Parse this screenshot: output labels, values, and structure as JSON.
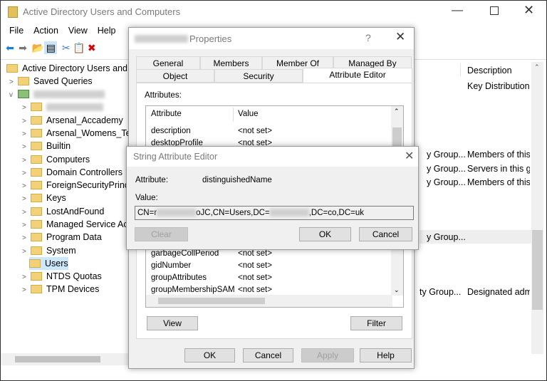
{
  "main": {
    "title": "Active Directory Users and Computers",
    "menu": [
      "File",
      "Action",
      "View",
      "Help"
    ],
    "tree": [
      {
        "label": "Active Directory Users and Computers",
        "chev": ""
      },
      {
        "label": "Saved Queries",
        "chev": ">"
      },
      {
        "label": "",
        "chev": "v"
      },
      {
        "label": "",
        "chev": ">"
      },
      {
        "label": "Arsenal_Accademy",
        "chev": ">"
      },
      {
        "label": "Arsenal_Womens_Tea",
        "chev": ">"
      },
      {
        "label": "Builtin",
        "chev": ">"
      },
      {
        "label": "Computers",
        "chev": ">"
      },
      {
        "label": "Domain Controllers",
        "chev": ">"
      },
      {
        "label": "ForeignSecurityPrinc",
        "chev": ">"
      },
      {
        "label": "Keys",
        "chev": ">"
      },
      {
        "label": "LostAndFound",
        "chev": ">"
      },
      {
        "label": "Managed Service Acc",
        "chev": ">"
      },
      {
        "label": "Program Data",
        "chev": ">"
      },
      {
        "label": "System",
        "chev": ">"
      },
      {
        "label": "Users",
        "chev": ""
      },
      {
        "label": "NTDS Quotas",
        "chev": ">"
      },
      {
        "label": "TPM Devices",
        "chev": ">"
      }
    ],
    "list": {
      "description_header": "Description",
      "rows": [
        {
          "type": "",
          "desc": "Key Distribution C"
        },
        {
          "type": "y Group...",
          "desc": "Members of this"
        },
        {
          "type": "y Group...",
          "desc": "Servers in this gro"
        },
        {
          "type": "y Group...",
          "desc": "Members of this"
        },
        {
          "type": "y Group...",
          "desc": ""
        },
        {
          "type": "ty Group...",
          "desc": "Designated admi"
        }
      ]
    }
  },
  "properties": {
    "title": "Properties",
    "help": "?",
    "tabs_row1": [
      "General",
      "Members",
      "Member Of",
      "Managed By"
    ],
    "tabs_row2": [
      "Object",
      "Security",
      "Attribute Editor"
    ],
    "attributes_label": "Attributes:",
    "columns": [
      "Attribute",
      "Value"
    ],
    "rows": [
      {
        "a": "description",
        "v": "<not set>"
      },
      {
        "a": "desktopProfile",
        "v": "<not set>"
      },
      {
        "a": "garbageCollPeriod",
        "v": "<not set>"
      },
      {
        "a": "gidNumber",
        "v": "<not set>"
      },
      {
        "a": "groupAttributes",
        "v": "<not set>"
      },
      {
        "a": "groupMembershipSAM",
        "v": "<not set>"
      }
    ],
    "view": "View",
    "filter": "Filter",
    "ok": "OK",
    "cancel": "Cancel",
    "apply": "Apply",
    "help_btn": "Help"
  },
  "editor": {
    "title": "String Attribute Editor",
    "attribute_label": "Attribute:",
    "attribute": "distinguishedName",
    "value_label": "Value:",
    "value_parts": [
      "CN=r",
      "oJC,CN=Users,DC=",
      ",DC=co,DC=uk"
    ],
    "clear": "Clear",
    "ok": "OK",
    "cancel": "Cancel"
  }
}
